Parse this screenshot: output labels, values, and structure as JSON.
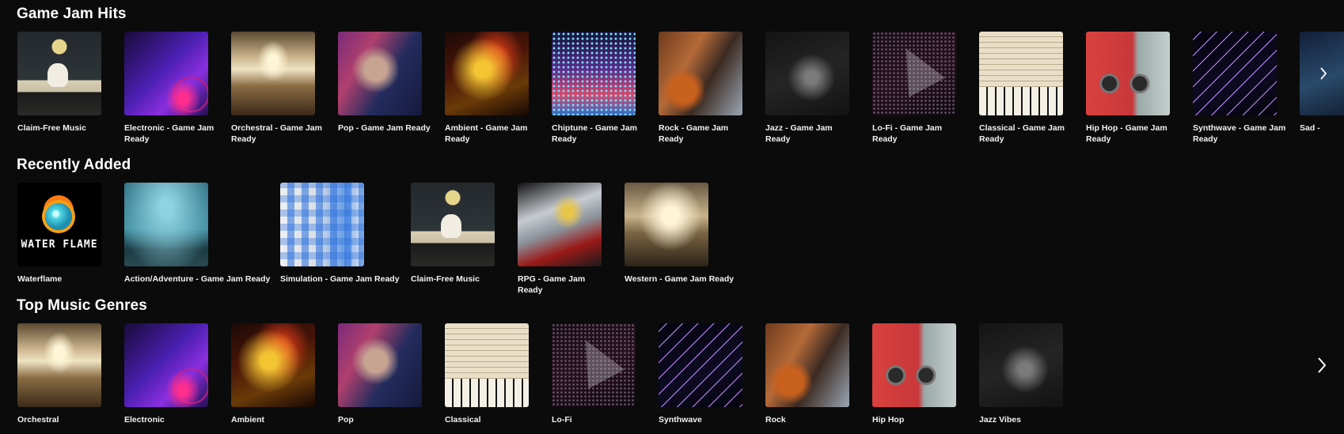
{
  "sections": [
    {
      "title": "Game Jam Hits",
      "items": [
        {
          "label": "Claim-Free Music",
          "art": "boat-cat"
        },
        {
          "label": "Electronic - Game Jam Ready",
          "art": "electronic"
        },
        {
          "label": "Orchestral - Game Jam Ready",
          "art": "orchestral"
        },
        {
          "label": "Pop - Game Jam Ready",
          "art": "pop"
        },
        {
          "label": "Ambient - Game Jam Ready",
          "art": "ambient"
        },
        {
          "label": "Chiptune - Game Jam Ready",
          "art": "chiptune"
        },
        {
          "label": "Rock - Game Jam Ready",
          "art": "rock"
        },
        {
          "label": "Jazz - Game Jam Ready",
          "art": "jazz"
        },
        {
          "label": "Lo-Fi - Game Jam Ready",
          "art": "lofi"
        },
        {
          "label": "Classical - Game Jam Ready",
          "art": "classical"
        },
        {
          "label": "Hip Hop - Game Jam Ready",
          "art": "hiphop"
        },
        {
          "label": "Synthwave - Game Jam Ready",
          "art": "synthwave"
        },
        {
          "label": "Sad -",
          "art": "sad"
        }
      ],
      "next_icon": "chevron-right-icon"
    },
    {
      "title": "Recently Added",
      "items": [
        {
          "label": "Waterflame",
          "art": "waterflame",
          "logo_text": "WATER FLAME"
        },
        {
          "label": "Action/Adventure - Game Jam Ready",
          "art": "action"
        },
        {
          "label": "Simulation - Game Jam Ready",
          "art": "simulation"
        },
        {
          "label": "Claim-Free Music",
          "art": "boat-cat"
        },
        {
          "label": "RPG - Game Jam Ready",
          "art": "rpg"
        },
        {
          "label": "Western - Game Jam Ready",
          "art": "western"
        }
      ]
    },
    {
      "title": "Top Music Genres",
      "items": [
        {
          "label": "Orchestral",
          "art": "orchestral"
        },
        {
          "label": "Electronic",
          "art": "electronic"
        },
        {
          "label": "Ambient",
          "art": "ambient"
        },
        {
          "label": "Pop",
          "art": "pop"
        },
        {
          "label": "Classical",
          "art": "classical"
        },
        {
          "label": "Lo-Fi",
          "art": "lofi"
        },
        {
          "label": "Synthwave",
          "art": "synthwave"
        },
        {
          "label": "Rock",
          "art": "rock"
        },
        {
          "label": "Hip Hop",
          "art": "hiphop"
        },
        {
          "label": "Jazz Vibes",
          "art": "jazz"
        }
      ],
      "next_icon": "chevron-right-icon"
    }
  ],
  "colors": {
    "background": "#0b0b0b",
    "text": "#ffffff"
  }
}
